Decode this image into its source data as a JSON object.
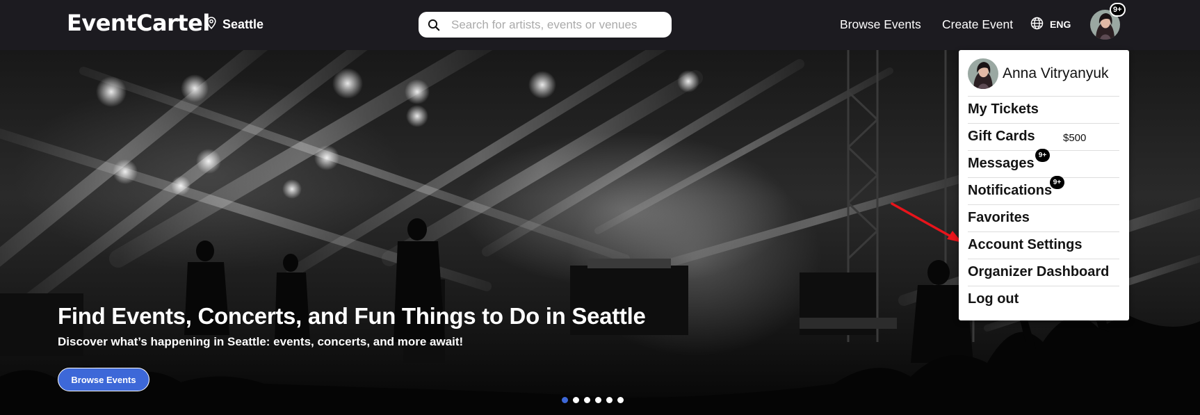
{
  "header": {
    "logo": "EventCartel",
    "location": "Seattle",
    "search_placeholder": "Search for artists, events or venues",
    "nav": {
      "browse": "Browse Events",
      "create": "Create Event"
    },
    "language": "ENG",
    "avatar_badge": "9+"
  },
  "hero": {
    "title": "Find Events, Concerts, and Fun Things to Do in Seattle",
    "subtitle": "Discover what’s happening in Seattle: events, concerts, and more await!",
    "button": "Browse Events",
    "slides": {
      "count": 6,
      "active": 1
    }
  },
  "dropdown": {
    "user_name": "Anna Vitryanyuk",
    "items": [
      {
        "label": "My Tickets"
      },
      {
        "label": "Gift Cards",
        "value": "$500"
      },
      {
        "label": "Messages",
        "badge": "9+"
      },
      {
        "label": "Notifications",
        "badge": "9+"
      },
      {
        "label": "Favorites"
      },
      {
        "label": "Account Settings"
      },
      {
        "label": "Organizer Dashboard"
      },
      {
        "label": "Log out"
      }
    ]
  },
  "colors": {
    "navbar": "#1c1b20",
    "accent": "#3d68d8",
    "annotation_arrow": "#e8141b"
  },
  "icons": {
    "location": "map-pin-icon",
    "search": "magnifier-icon",
    "language": "globe-icon"
  }
}
